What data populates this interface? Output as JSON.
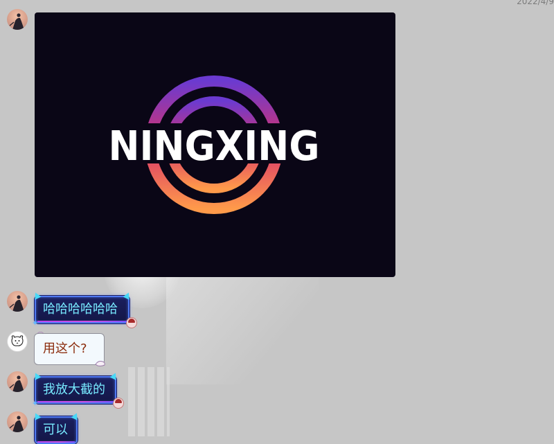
{
  "chat": {
    "timestamp": "2022/4/9",
    "image_message": {
      "logo_text": "NINGXING"
    },
    "messages": [
      {
        "sender": "self",
        "text": "哈哈哈哈哈哈"
      },
      {
        "sender": "other",
        "text": "用这个?"
      },
      {
        "sender": "self",
        "text": "我放大截的"
      },
      {
        "sender": "self",
        "text": "可以"
      }
    ]
  },
  "colors": {
    "background": "#c6c6c6",
    "image_background": "#0a0616",
    "logo_ring_top": "#6b3ad0",
    "logo_ring_mid": "#d8336c",
    "logo_ring_bottom": "#ff9a4a",
    "bubble_dark_fill": "#171a52",
    "bubble_dark_border": "#4f78f2",
    "bubble_dark_text": "#78eaff",
    "bubble_light_fill": "#f3f9fd",
    "bubble_light_text": "#8a2a0a"
  },
  "icons": {
    "self_avatar": "dusk-silhouette-avatar",
    "other_avatar": "cartoon-dog-avatar"
  }
}
